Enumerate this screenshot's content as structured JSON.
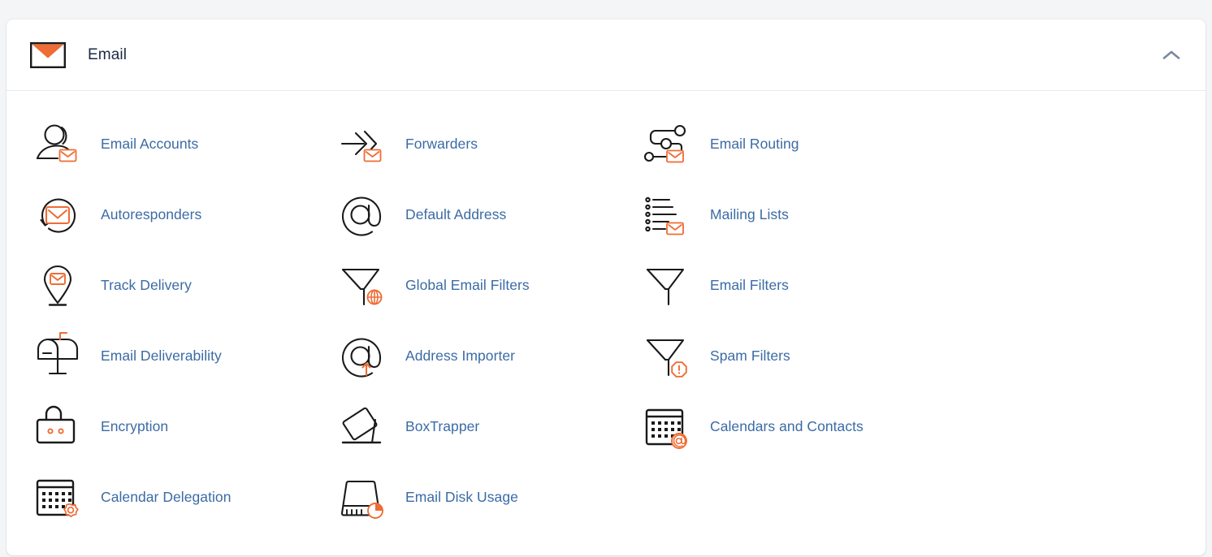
{
  "section": {
    "title": "Email",
    "header_icon": "envelope-icon",
    "collapse_icon": "chevron-up-icon",
    "collapse_label": "Collapse",
    "colors": {
      "page_background": "#f4f5f7",
      "card_background": "#ffffff",
      "title_text": "#1b2b45",
      "link_text": "#3b6ba5",
      "accent_orange": "#ef6c35",
      "icon_line": "#1a1a1a",
      "divider": "#e6eaf0",
      "chevron": "#7a88a0"
    },
    "items": [
      {
        "label": "Email Accounts",
        "icon": "user-envelope-icon"
      },
      {
        "label": "Forwarders",
        "icon": "arrows-forward-envelope-icon"
      },
      {
        "label": "Email Routing",
        "icon": "routing-nodes-envelope-icon"
      },
      {
        "label": "Autoresponders",
        "icon": "circular-arrow-envelope-icon"
      },
      {
        "label": "Default Address",
        "icon": "at-sign-icon"
      },
      {
        "label": "Mailing Lists",
        "icon": "bullet-list-envelope-icon"
      },
      {
        "label": "Track Delivery",
        "icon": "map-pin-envelope-icon"
      },
      {
        "label": "Global Email Filters",
        "icon": "funnel-globe-icon"
      },
      {
        "label": "Email Filters",
        "icon": "funnel-icon"
      },
      {
        "label": "Email Deliverability",
        "icon": "mailbox-flag-icon"
      },
      {
        "label": "Address Importer",
        "icon": "at-sign-up-arrow-icon"
      },
      {
        "label": "Spam Filters",
        "icon": "funnel-alert-icon"
      },
      {
        "label": "Encryption",
        "icon": "padlock-icon"
      },
      {
        "label": "BoxTrapper",
        "icon": "box-trap-icon"
      },
      {
        "label": "Calendars and Contacts",
        "icon": "calendar-at-icon"
      },
      {
        "label": "Calendar Delegation",
        "icon": "calendar-gear-icon"
      },
      {
        "label": "Email Disk Usage",
        "icon": "disk-pie-icon"
      }
    ]
  }
}
